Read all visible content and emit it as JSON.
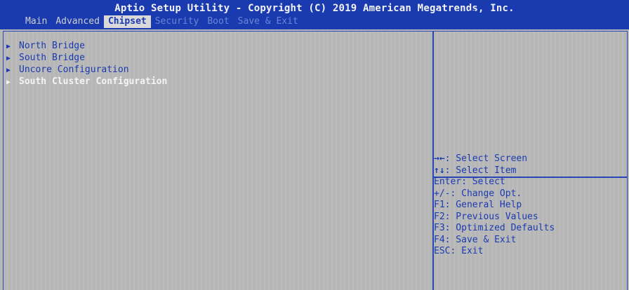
{
  "header": {
    "title": "Aptio Setup Utility - Copyright (C) 2019 American Megatrends, Inc.",
    "tabs": [
      {
        "label": "Main",
        "state": "normal"
      },
      {
        "label": "Advanced",
        "state": "normal"
      },
      {
        "label": "Chipset",
        "state": "active"
      },
      {
        "label": "Security",
        "state": "dim"
      },
      {
        "label": "Boot",
        "state": "dim"
      },
      {
        "label": "Save & Exit",
        "state": "dim"
      }
    ]
  },
  "menu": {
    "arrow_glyph": "▶",
    "items": [
      {
        "label": "North Bridge"
      },
      {
        "label": "South Bridge"
      },
      {
        "label": "Uncore Configuration"
      },
      {
        "label": "South Cluster Configuration",
        "selected": true
      }
    ]
  },
  "help": {
    "description": "South Cluster Configuration"
  },
  "keys": [
    {
      "key": "→←",
      "text": ": Select Screen"
    },
    {
      "key": "↑↓",
      "text": ": Select Item"
    },
    {
      "key": "Enter",
      "text": ": Select"
    },
    {
      "key": "+/-",
      "text": ": Change Opt."
    },
    {
      "key": "F1",
      "text": ": General Help"
    },
    {
      "key": "F2",
      "text": ": Previous Values"
    },
    {
      "key": "F3",
      "text": ": Optimized Defaults"
    },
    {
      "key": "F4",
      "text": ": Save & Exit"
    },
    {
      "key": "ESC",
      "text": ": Exit"
    }
  ],
  "colors": {
    "header_bg": "#1a3bb0",
    "panel_bg": "#b9b9b9",
    "text_blue": "#1a3bb0",
    "selected_text": "#f4f4f4"
  }
}
